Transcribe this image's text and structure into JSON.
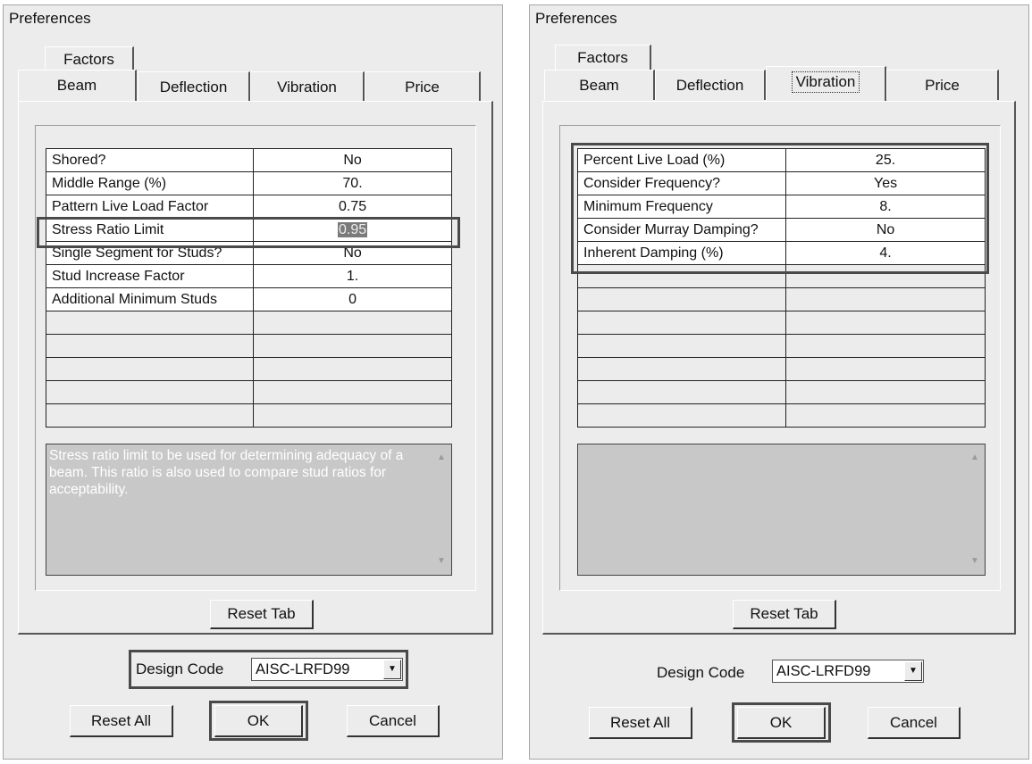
{
  "left": {
    "title": "Preferences",
    "tabs": {
      "factors": "Factors",
      "beam": "Beam",
      "deflection": "Deflection",
      "vibration": "Vibration",
      "price": "Price"
    },
    "rows": [
      {
        "label": "Shored?",
        "value": "No"
      },
      {
        "label": "Middle Range (%)",
        "value": "70."
      },
      {
        "label": "Pattern Live Load Factor",
        "value": "0.75"
      },
      {
        "label": "Stress Ratio Limit",
        "value": "0.95"
      },
      {
        "label": "Single Segment for Studs?",
        "value": "No"
      },
      {
        "label": "Stud Increase Factor",
        "value": "1."
      },
      {
        "label": "Additional Minimum Studs",
        "value": "0"
      }
    ],
    "description": "Stress ratio limit to be used for determining adequacy of a beam. This ratio is also used to compare stud ratios for acceptability.",
    "reset_tab": "Reset Tab",
    "design_code_label": "Design Code",
    "design_code_value": "AISC-LRFD99",
    "reset_all": "Reset All",
    "ok": "OK",
    "cancel": "Cancel"
  },
  "right": {
    "title": "Preferences",
    "tabs": {
      "factors": "Factors",
      "beam": "Beam",
      "deflection": "Deflection",
      "vibration": "Vibration",
      "price": "Price"
    },
    "rows": [
      {
        "label": "Percent Live Load (%)",
        "value": "25."
      },
      {
        "label": "Consider Frequency?",
        "value": "Yes"
      },
      {
        "label": "Minimum Frequency",
        "value": "8."
      },
      {
        "label": "Consider Murray Damping?",
        "value": "No"
      },
      {
        "label": "Inherent Damping (%)",
        "value": "4."
      }
    ],
    "description": "",
    "reset_tab": "Reset Tab",
    "design_code_label": "Design Code",
    "design_code_value": "AISC-LRFD99",
    "reset_all": "Reset All",
    "ok": "OK",
    "cancel": "Cancel"
  }
}
